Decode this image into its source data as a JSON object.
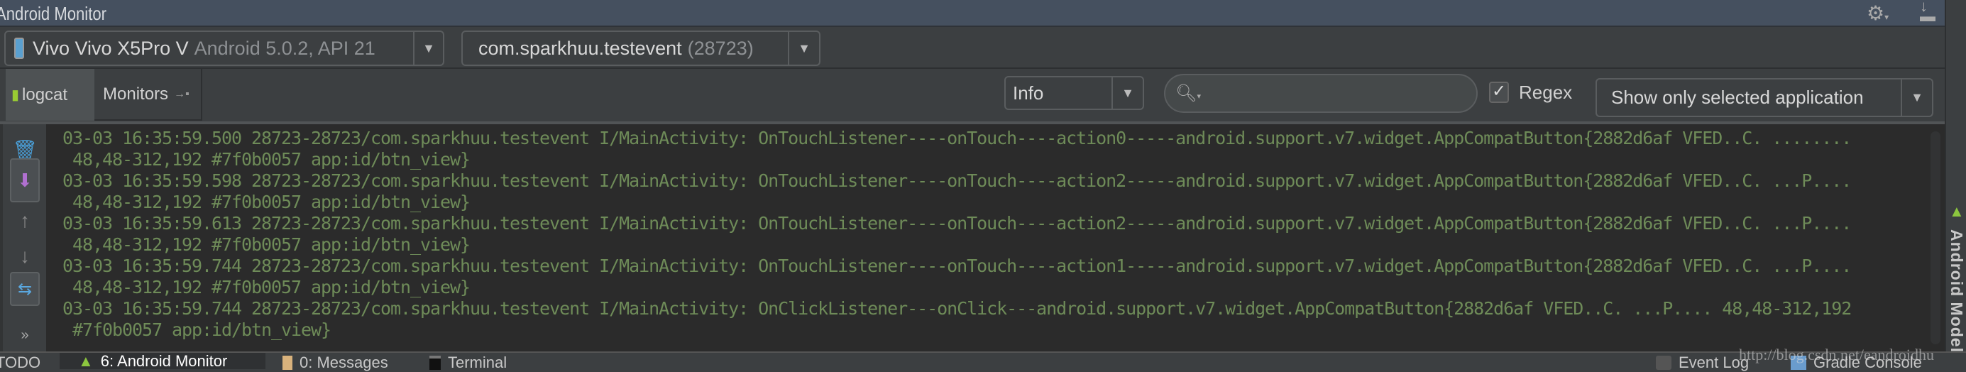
{
  "window": {
    "title": "Android Monitor"
  },
  "device_selector": {
    "device": "Vivo Vivo X5Pro V",
    "detail": "Android 5.0.2, API 21"
  },
  "process_selector": {
    "package": "com.sparkhuu.testevent",
    "pid": "(28723)"
  },
  "tabs": [
    {
      "label": "logcat",
      "active": true
    },
    {
      "label": "Monitors",
      "active": false
    }
  ],
  "toolbar": {
    "log_level": "Info",
    "search": {
      "value": "",
      "placeholder": ""
    },
    "regex_label": "Regex",
    "regex_checked": true,
    "filter": "Show only selected application"
  },
  "log_lines": [
    "03-03 16:35:59.500 28723-28723/com.sparkhuu.testevent I/MainActivity: OnTouchListener----onTouch----action0-----android.support.v7.widget.AppCompatButton{2882d6af VFED..C. ........",
    " 48,48-312,192 #7f0b0057 app:id/btn_view}",
    "03-03 16:35:59.598 28723-28723/com.sparkhuu.testevent I/MainActivity: OnTouchListener----onTouch----action2-----android.support.v7.widget.AppCompatButton{2882d6af VFED..C. ...P....",
    " 48,48-312,192 #7f0b0057 app:id/btn_view}",
    "03-03 16:35:59.613 28723-28723/com.sparkhuu.testevent I/MainActivity: OnTouchListener----onTouch----action2-----android.support.v7.widget.AppCompatButton{2882d6af VFED..C. ...P....",
    " 48,48-312,192 #7f0b0057 app:id/btn_view}",
    "03-03 16:35:59.744 28723-28723/com.sparkhuu.testevent I/MainActivity: OnTouchListener----onTouch----action1-----android.support.v7.widget.AppCompatButton{2882d6af VFED..C. ...P....",
    " 48,48-312,192 #7f0b0057 app:id/btn_view}",
    "03-03 16:35:59.744 28723-28723/com.sparkhuu.testevent I/MainActivity: OnClickListener---onClick---android.support.v7.widget.AppCompatButton{2882d6af VFED..C. ...P.... 48,48-312,192",
    " #7f0b0057 app:id/btn_view}"
  ],
  "right_panel": {
    "label": "Android Model"
  },
  "bottom_bar": {
    "todo": "TODO",
    "android_monitor": "6: Android Monitor",
    "messages": "0: Messages",
    "terminal": "Terminal",
    "event_log": "Event Log",
    "gradle_console": "Gradle Console"
  },
  "watermark": "http://blog.csdn.net/eandroidhu",
  "colors": {
    "log_info": "#6e8b58",
    "title_bar": "#45505f",
    "log_bg": "#2b2b2b",
    "panel": "#3c3f41"
  }
}
